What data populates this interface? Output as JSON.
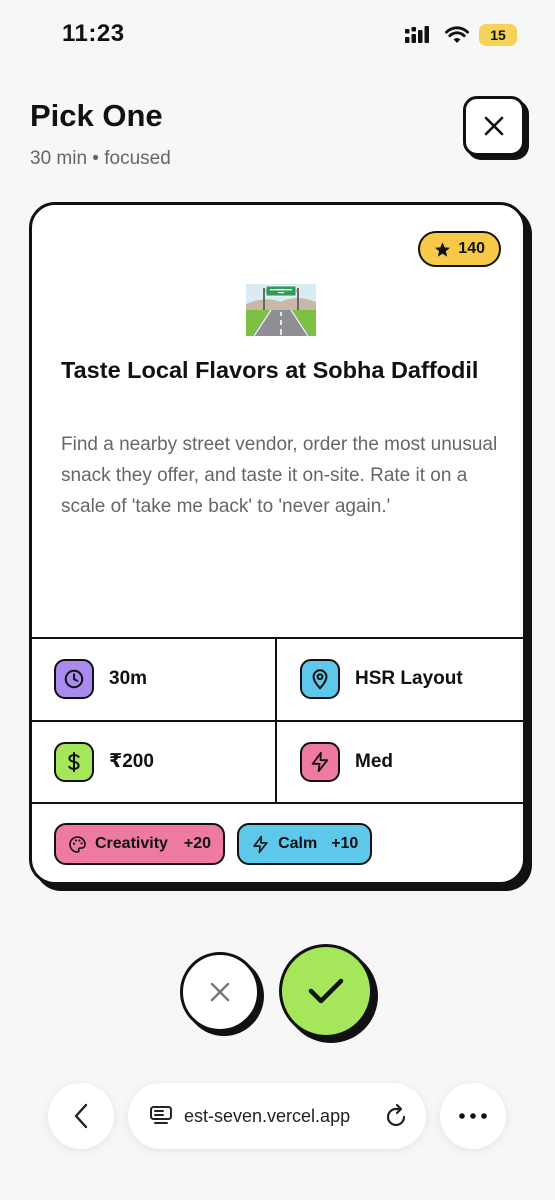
{
  "status_bar": {
    "time": "11:23",
    "battery": "15"
  },
  "header": {
    "title": "Pick One",
    "subtitle": "30 min • focused"
  },
  "card": {
    "points": "140",
    "title": "Taste Local Flavors at Sobha Daffodil",
    "description": "Find a nearby street vendor, order the most unusual snack they offer, and taste it on-site. Rate it on a scale of 'take me back' to 'never again.'",
    "stats": {
      "duration": "30m",
      "location": "HSR Layout",
      "cost": "₹200",
      "effort": "Med"
    },
    "tags": [
      {
        "label": "Creativity",
        "value": "+20",
        "color": "#ee7aa4"
      },
      {
        "label": "Calm",
        "value": "+10",
        "color": "#5ec8ea"
      }
    ],
    "icon_colors": {
      "clock": "#a98bf0",
      "pin": "#5ec8ea",
      "dollar": "#a6e65a",
      "bolt": "#ee7aa4"
    }
  },
  "browser": {
    "url": "est-seven.vercel.app"
  }
}
